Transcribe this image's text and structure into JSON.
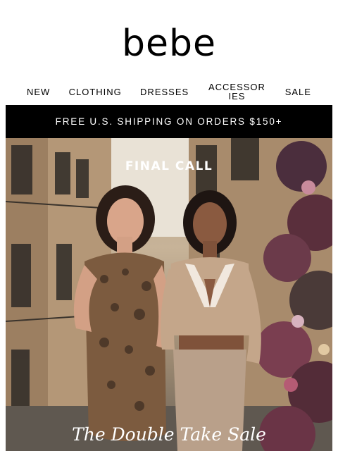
{
  "brand": {
    "logo_text": "bebe"
  },
  "nav": {
    "items": [
      {
        "label": "NEW"
      },
      {
        "label": "CLOTHING"
      },
      {
        "label": "DRESSES"
      },
      {
        "label": "ACCESSORIES"
      },
      {
        "label": "SALE"
      }
    ]
  },
  "banner": {
    "text": "FREE U.S. SHIPPING ON ORDERS $150+"
  },
  "hero": {
    "headline": "FINAL CALL",
    "title": "The Double Take Sale"
  },
  "colors": {
    "banner_bg": "#000000",
    "banner_text": "#ffffff",
    "hero_text": "#ffffff"
  }
}
